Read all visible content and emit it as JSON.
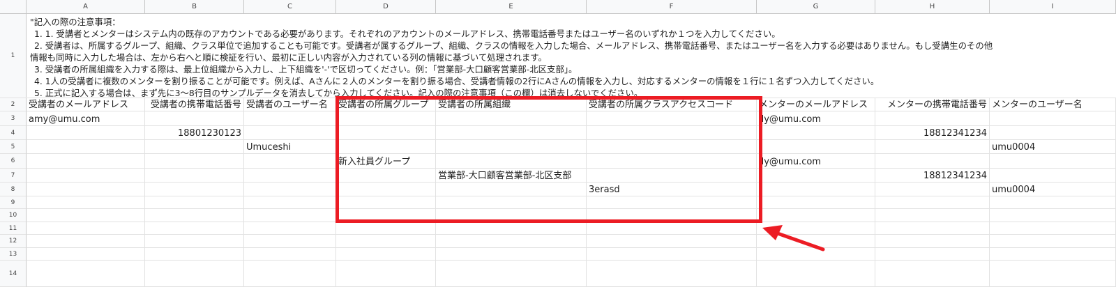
{
  "columns": [
    "A",
    "B",
    "C",
    "D",
    "E",
    "F",
    "G",
    "H",
    "I"
  ],
  "row_numbers": [
    "1",
    "2",
    "3",
    "4",
    "5",
    "6",
    "7",
    "8",
    "9",
    "10",
    "11",
    "12",
    "13",
    "14"
  ],
  "notes": {
    "line0": "\"記入の際の注意事項：",
    "line1": "1. 1. 受講者とメンターはシステム内の既存のアカウントである必要があります。それぞれのアカウントのメールアドレス、携帯電話番号またはユーザー名のいずれか１つを入力してください。",
    "line2a": "2. 受講者は、所属するグループ、組織、クラス単位で追加することも可能です。受講者が属するグループ、組織、クラスの情報を入力した場合、メールアドレス、携帯電話番号、またはユーザー名を入力する必要はありません。もし受講生のその他",
    "line2b": "情報も同時に入力した場合は、左から右へと順に検証を行い、最初に正しい内容が入力されている列の情報に基づいて処理されます。",
    "line3": "3. 受講者の所属組織を入力する際は、最上位組織から入力し、上下組織を'-'で区切ってください。例：「営業部-大口顧客営業部-北区支部」。",
    "line4": "4. 1人の受講者に複数のメンターを割り振ることが可能です。例えば、Aさんに２人のメンターを割り振る場合、受講者情報の2行にAさんの情報を入力し、対応するメンターの情報を１行に１名ずつ入力してください。",
    "line5": "5. 正式に記入する場合は、まず先に3～8行目のサンプルデータを消去してから入力してください。記入の際の注意事項（この欄）は消去しないでください。"
  },
  "headers": {
    "A": "受講者のメールアドレス",
    "B": "受講者の携帯電話番号",
    "C": "受講者のユーザー名",
    "D": "受講者の所属グループ",
    "E": "受講者の所属組織",
    "F": "受講者の所属クラスアクセスコード",
    "G": "メンターのメールアドレス",
    "H": "メンターの携帯電話番号",
    "I": "メンターのユーザー名"
  },
  "rows": {
    "r3": {
      "A": "amy@umu.com",
      "G": "lly@umu.com"
    },
    "r4": {
      "B": "18801230123",
      "H": "18812341234"
    },
    "r5": {
      "C": "Umuceshi",
      "I": "umu0004"
    },
    "r6": {
      "D": "新入社員グループ",
      "G": "lly@umu.com"
    },
    "r7": {
      "E": "営業部-大口顧客営業部-北区支部",
      "H": "18812341234"
    },
    "r8": {
      "F": "3erasd",
      "I": "umu0004"
    }
  },
  "annotation_color": "#ec1c24"
}
